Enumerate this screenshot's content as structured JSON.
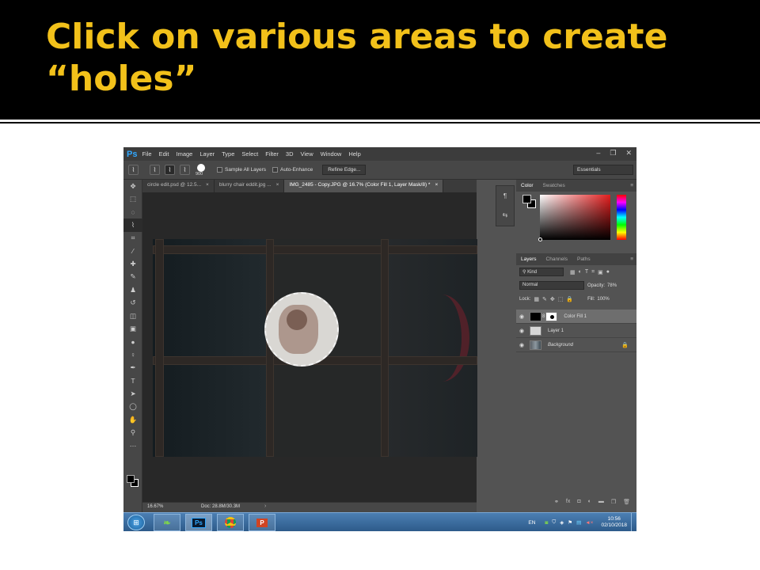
{
  "slide": {
    "title_line1": "Click on various areas to create",
    "title_line2": "“holes”"
  },
  "photoshop": {
    "logo": "Ps",
    "menu": [
      "File",
      "Edit",
      "Image",
      "Layer",
      "Type",
      "Select",
      "Filter",
      "3D",
      "View",
      "Window",
      "Help"
    ],
    "window_controls": [
      "–",
      "❐",
      "✕"
    ],
    "options_bar": {
      "brush_size": "900",
      "sample_all_layers": "Sample All Layers",
      "auto_enhance": "Auto-Enhance",
      "refine_edge": "Refine Edge...",
      "workspace": "Essentials"
    },
    "tabs": [
      {
        "label": "circle edit.psd @ 12.5...",
        "close": "×"
      },
      {
        "label": "blurry chair eddit.jpg ...",
        "close": "×"
      },
      {
        "label": "IMG_2485 - Copy.JPG @ 16.7% (Color Fill 1, Layer Mask/8) *",
        "close": "×"
      }
    ],
    "status": {
      "zoom": "16.67%",
      "doc": "Doc: 28.8M/30.3M",
      "arrow": "›"
    },
    "color_panel": {
      "tabs": [
        "Color",
        "Swatches"
      ],
      "menu_icon": "≡"
    },
    "layers_panel": {
      "tabs": [
        "Layers",
        "Channels",
        "Paths"
      ],
      "menu_icon": "≡",
      "kind_filter": "Kind",
      "blend_mode": "Normal",
      "opacity_label": "Opacity:",
      "opacity_value": "78%",
      "lock_label": "Lock:",
      "fill_label": "Fill:",
      "fill_value": "100%",
      "layers": [
        {
          "name": "Color Fill 1",
          "selected": true
        },
        {
          "name": "Layer 1",
          "selected": false
        },
        {
          "name": "Background",
          "selected": false
        }
      ],
      "footer_icons": [
        "link-icon",
        "fx-icon",
        "mask-icon",
        "adjustment-icon",
        "folder-icon",
        "new-layer-icon",
        "trash-icon"
      ],
      "footer_glyphs": [
        "⚭",
        "fx",
        "◘",
        "◐",
        "▬",
        "❐",
        "🗑"
      ]
    },
    "taskbar": {
      "apps": [
        "explorer",
        "photoshop",
        "chrome",
        "powerpoint"
      ],
      "ps_label": "Ps",
      "ppt_label": "P",
      "language": "EN",
      "time": "10:56",
      "date": "02/10/2018"
    }
  }
}
